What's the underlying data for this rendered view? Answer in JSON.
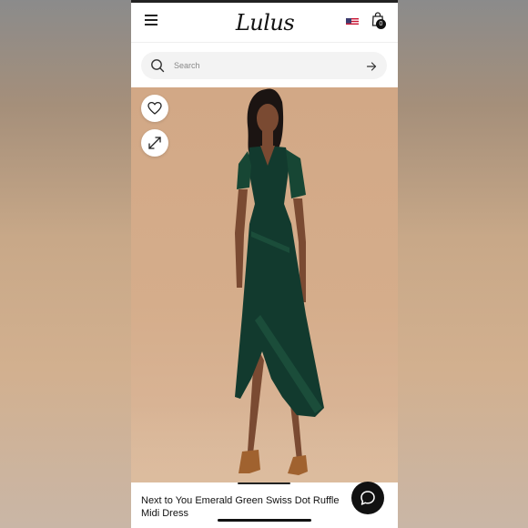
{
  "header": {
    "brand": "Lulus",
    "bag_count": "0",
    "icons": {
      "menu": "hamburger-menu-icon",
      "flag": "us-flag-icon",
      "bag": "shopping-bag-icon"
    }
  },
  "search": {
    "placeholder": "Search",
    "value": "",
    "icons": {
      "search": "search-icon",
      "submit": "arrow-right-icon"
    }
  },
  "product": {
    "title": "Next to You Emerald Green Swiss Dot Ruffle Midi Dress",
    "dress_color": "#123a2e",
    "background_color": "#d4ab8a",
    "actions": {
      "wishlist_icon": "heart-icon",
      "expand_icon": "expand-icon"
    }
  },
  "chat": {
    "icon": "chat-bubble-icon"
  },
  "colors": {
    "accent": "#111111",
    "surface": "#ffffff",
    "search_bg": "#f3f3f3"
  }
}
